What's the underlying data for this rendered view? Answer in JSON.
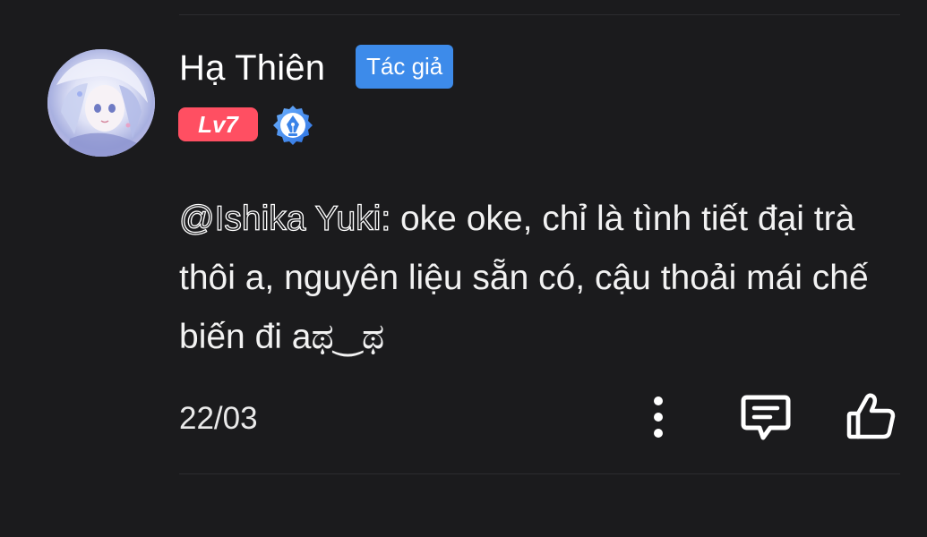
{
  "comment": {
    "user": {
      "name": "Hạ Thiên",
      "role_badge": "Tác giả",
      "level": "Lv7",
      "avatar_icon": "avatar-image",
      "verified_icon": "pen-nib-badge-icon"
    },
    "mention": "@Ishika Yuki:",
    "text": " oke oke, chỉ là tình tiết đại trà thôi a, nguyên liệu sẵn có, cậu thoải mái chế biến đi aಥ‿ಥ",
    "date": "22/03"
  },
  "actions": {
    "more_icon": "more-vertical-icon",
    "reply_icon": "comment-icon",
    "like_icon": "thumbs-up-icon"
  },
  "colors": {
    "background": "#1b1b1d",
    "author_badge": "#3d8bea",
    "level_badge": "#ff4f62",
    "text": "#ffffff"
  }
}
